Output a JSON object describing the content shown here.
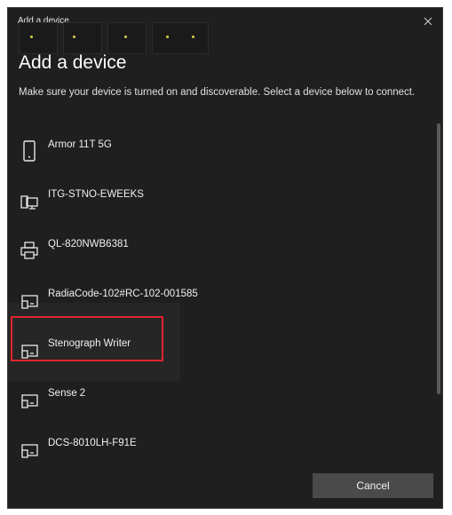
{
  "window": {
    "title": "Add a device"
  },
  "heading": "Add a device",
  "description": "Make sure your device is turned on and discoverable. Select a device below to connect.",
  "devices": [
    {
      "name": "Armor 11T 5G",
      "icon": "phone-icon"
    },
    {
      "name": "ITG-STNO-EWEEKS",
      "icon": "computer-icon"
    },
    {
      "name": "QL-820NWB6381",
      "icon": "printer-icon"
    },
    {
      "name": "RadiaCode-102#RC-102-001585",
      "icon": "generic-device-icon"
    },
    {
      "name": "Stenograph Writer",
      "icon": "generic-device-icon"
    },
    {
      "name": "Sense 2",
      "icon": "generic-device-icon"
    },
    {
      "name": "DCS-8010LH-F91E",
      "icon": "generic-device-icon"
    }
  ],
  "footer": {
    "cancel_label": "Cancel"
  },
  "colors": {
    "background": "#1f1f1f",
    "highlight": "#e0252b",
    "button": "#4a4a4a"
  }
}
